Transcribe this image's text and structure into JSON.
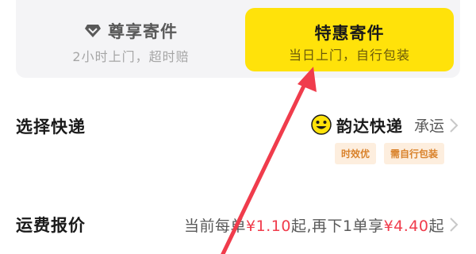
{
  "options": {
    "premium": {
      "title": "尊享寄件",
      "subtitle": "2小时上门，超时赔",
      "icon": "diamond-icon"
    },
    "discount": {
      "title": "特惠寄件",
      "subtitle": "当日上门，自行包装"
    }
  },
  "courier": {
    "label": "选择快递",
    "name": "韵达快递",
    "suffix": "承运",
    "logo": "yunda-smile-icon",
    "tags": [
      "时效优",
      "需自行包装"
    ]
  },
  "price": {
    "label": "运费报价",
    "prefix": "当前每单",
    "current_price": "¥1.10",
    "middle": "起,再下1单享",
    "next_price": "¥4.40",
    "suffix": "起"
  },
  "colors": {
    "accent_yellow": "#ffe20a",
    "price_red": "#f03c4c",
    "tag_orange": "#d9822b",
    "annotation_arrow": "#f03c4c"
  }
}
